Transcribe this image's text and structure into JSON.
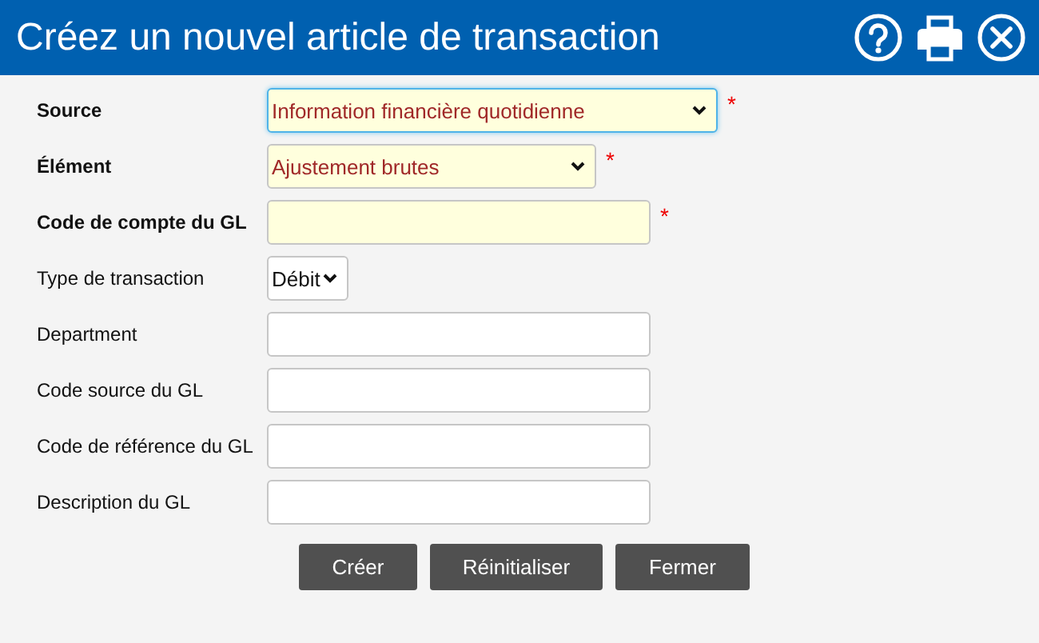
{
  "window": {
    "title": "Créez un nouvel article de transaction"
  },
  "fields": [
    {
      "label": "Source",
      "kind": "select",
      "value": "Information financière quotidienne",
      "required": true,
      "required_mark": "*",
      "focused": true
    },
    {
      "label": "Élément",
      "kind": "select",
      "value": "Ajustement brutes",
      "required": true,
      "required_mark": "*",
      "focused": false
    },
    {
      "label": "Code de compte du GL",
      "kind": "input",
      "required": true,
      "required_mark": "*",
      "focused": false
    },
    {
      "label": "Type de transaction",
      "kind": "select",
      "value": "Débit",
      "required": false,
      "focused": false
    },
    {
      "label": "Department",
      "kind": "input",
      "required": false,
      "focused": false
    },
    {
      "label": "Code source du GL",
      "kind": "input",
      "required": false,
      "focused": false
    },
    {
      "label": "Code de référence du GL",
      "kind": "input",
      "required": false,
      "focused": false
    },
    {
      "label": "Description du GL",
      "kind": "input",
      "required": false,
      "focused": false
    }
  ],
  "buttons": [
    "Créer",
    "Réinitialiser",
    "Fermer"
  ]
}
